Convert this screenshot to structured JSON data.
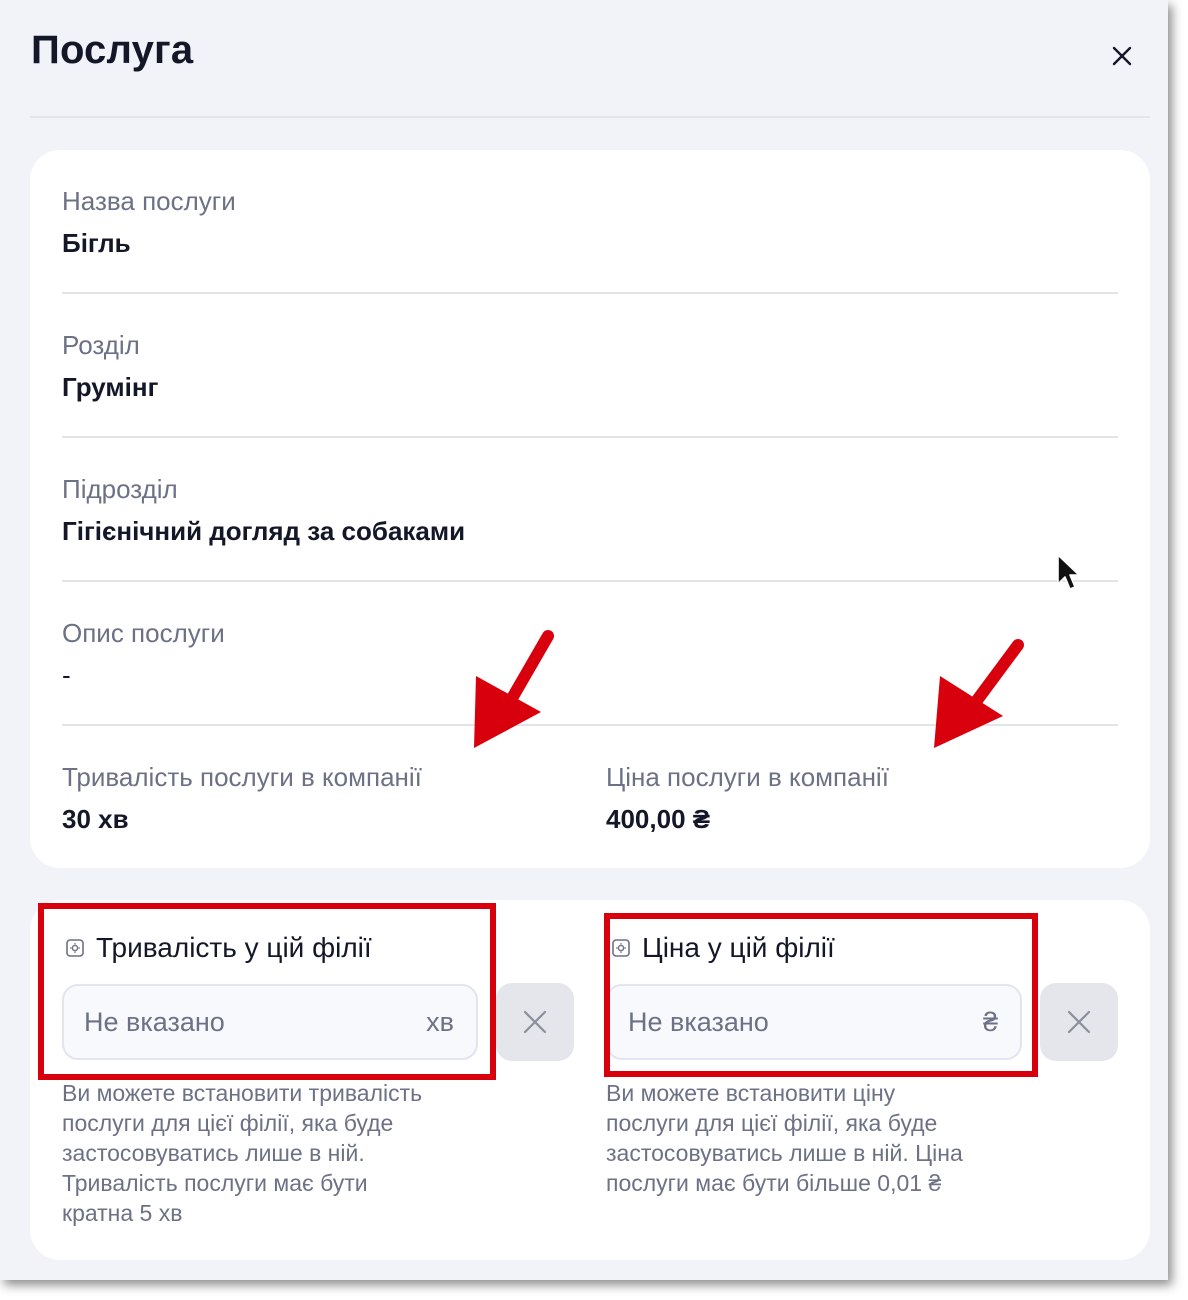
{
  "dialog": {
    "title": "Послуга"
  },
  "info": {
    "service_name": {
      "label": "Назва послуги",
      "value": "Бігль"
    },
    "section": {
      "label": "Розділ",
      "value": "Грумінг"
    },
    "subsection": {
      "label": "Підрозділ",
      "value": "Гігієнічний догляд за собаками"
    },
    "description": {
      "label": "Опис послуги",
      "value": "-"
    },
    "company_duration": {
      "label": "Тривалість послуги в компанії",
      "value": "30 хв"
    },
    "company_price": {
      "label": "Ціна послуги в компанії",
      "value": "400,00 ₴"
    }
  },
  "branch": {
    "duration": {
      "label": "Тривалість у цій філії",
      "placeholder": "Не вказано",
      "unit": "хв",
      "hint_lines": [
        "Ви можете встановити тривалість",
        "послуги для цієї філії, яка буде",
        "застосовуватись лише в ній.",
        "Тривалість послуги має бути",
        "кратна 5 хв"
      ]
    },
    "price": {
      "label": "Ціна у цій філії",
      "placeholder": "Не вказано",
      "unit": "₴",
      "hint_lines": [
        "Ви можете встановити ціну",
        "послуги для цієї філії, яка буде",
        "застосовуватись лише в ній. Ціна",
        "послуги має бути більше 0,01 ₴"
      ]
    }
  },
  "icons": {
    "close": "close-icon",
    "settings": "settings-box-icon",
    "clear": "clear-icon",
    "cursor": "mouse-pointer-icon",
    "annotation_arrow": "red-arrow-icon"
  },
  "colors": {
    "background": "#f2f3f9",
    "card": "#ffffff",
    "text_primary": "#141728",
    "text_secondary": "#6d7186",
    "annotation_red": "#d9000d",
    "clear_button": "#e5e6eb"
  }
}
